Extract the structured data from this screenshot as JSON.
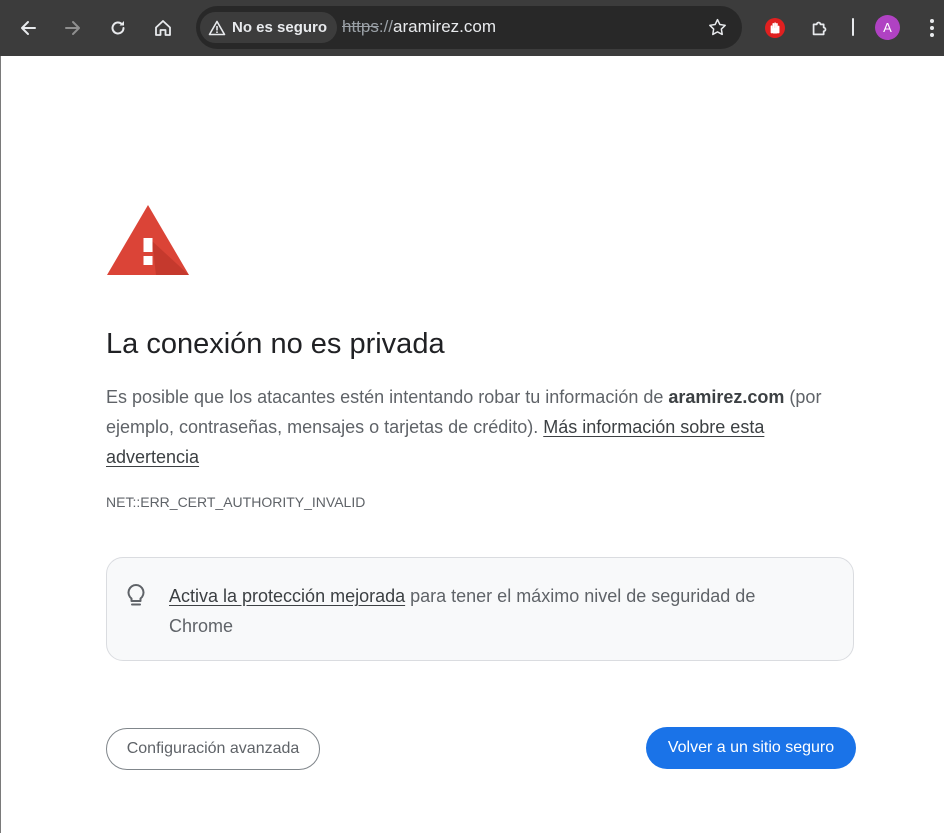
{
  "browser": {
    "security_chip": "No es seguro",
    "url_scheme": "https",
    "url_separator": "://",
    "url_host": "aramirez.com",
    "avatar_initial": "A",
    "icons": {
      "back": "back-arrow-icon",
      "forward": "forward-arrow-icon",
      "reload": "reload-icon",
      "home": "home-icon",
      "warning": "warning-triangle-icon",
      "bookmark": "star-icon",
      "stop_extension": "red-hand-icon",
      "extensions": "puzzle-icon",
      "menu": "kebab-menu-icon"
    }
  },
  "interstitial": {
    "title": "La conexión no es privada",
    "explanation_part1": "Es posible que los atacantes estén intentando robar tu información de ",
    "explanation_domain": "aramirez.com",
    "explanation_part2": " (por ejemplo, contraseñas, mensajes o tarjetas de crédito). ",
    "learn_more_link": "Más información sobre esta advertencia",
    "error_code": "NET::ERR_CERT_AUTHORITY_INVALID",
    "tip_link": "Activa la protección mejorada",
    "tip_text": " para tener el máximo nivel de seguridad de Chrome",
    "advanced_button": "Configuración avanzada",
    "back_to_safety_button": "Volver a un sitio seguro"
  },
  "colors": {
    "toolbar_bg": "#3c3c3c",
    "omnibox_bg": "#282828",
    "warning_red": "#db4437",
    "primary_blue": "#1a73e8",
    "avatar_purple": "#b042c3"
  }
}
